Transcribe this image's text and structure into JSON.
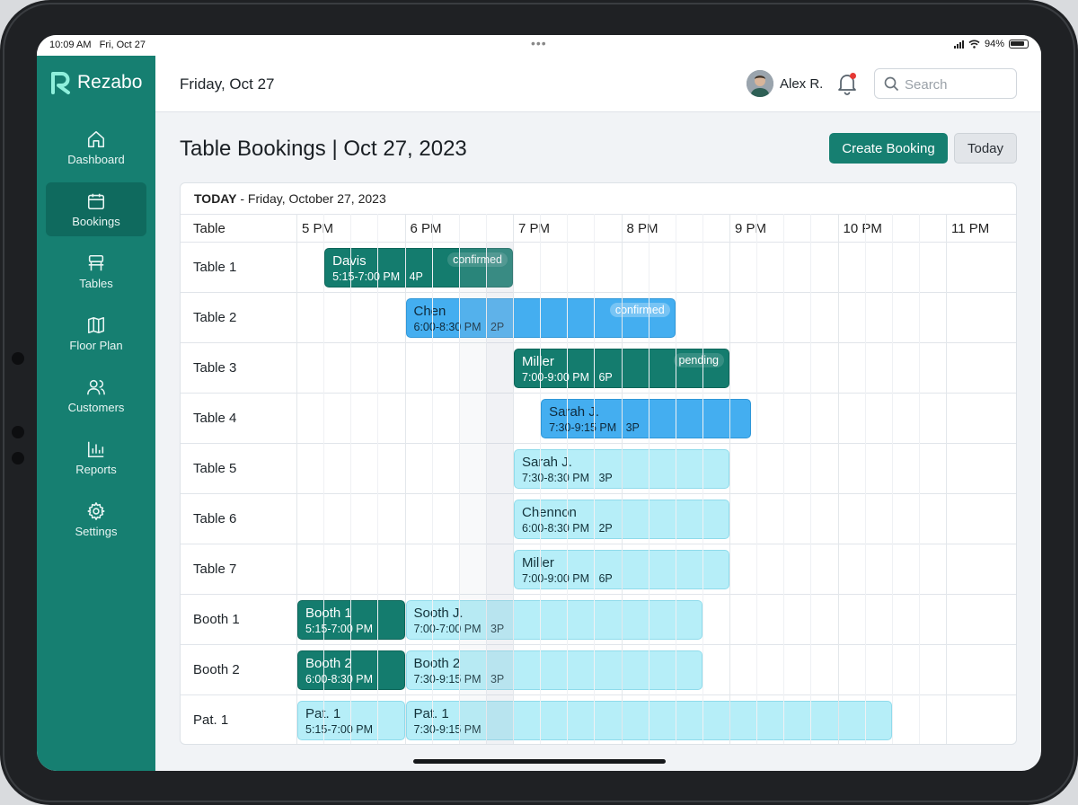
{
  "status_bar": {
    "time": "10:09 AM",
    "date": "Fri, Oct 27",
    "battery": "94%"
  },
  "brand": {
    "name": "Rezabo",
    "color": "#167f71"
  },
  "sidebar": {
    "items": [
      {
        "label": "Dashboard",
        "icon": "home-icon",
        "active": false
      },
      {
        "label": "Bookings",
        "icon": "calendar-icon",
        "active": true
      },
      {
        "label": "Tables",
        "icon": "chair-icon",
        "active": false
      },
      {
        "label": "Floor Plan",
        "icon": "map-icon",
        "active": false
      },
      {
        "label": "Customers",
        "icon": "users-icon",
        "active": false
      },
      {
        "label": "Reports",
        "icon": "bar-chart-icon",
        "active": false
      },
      {
        "label": "Settings",
        "icon": "gear-icon",
        "active": false
      }
    ]
  },
  "header": {
    "date": "Friday, Oct 27",
    "user_name": "Alex R.",
    "search_placeholder": "Search"
  },
  "page": {
    "title": "Table Bookings | Oct 27, 2023",
    "create_label": "Create Booking",
    "today_label": "Today"
  },
  "schedule": {
    "today_label": "TODAY",
    "date_label": " - Friday, October 27, 2023",
    "table_col": "Table",
    "hours": [
      "5 PM",
      "6 PM",
      "7 PM",
      "8 PM",
      "9 PM",
      "10 PM",
      "11 PM"
    ],
    "rows": [
      "Table 1",
      "Table 2",
      "Table 3",
      "Table 4",
      "Table 5",
      "Table 6",
      "Table 7",
      "Booth 1",
      "Booth 2",
      "Pat. 1"
    ],
    "bookings": [
      {
        "row": 0,
        "start": 17.25,
        "end": 19.0,
        "name": "Davis",
        "time": "5:15-7:00 PM",
        "party": "4P",
        "status": "confirmed",
        "style": "teal"
      },
      {
        "row": 1,
        "start": 18.0,
        "end": 20.5,
        "name": "Chen",
        "time": "6:00-8:30 PM",
        "party": "2P",
        "status": "confirmed",
        "style": "blue"
      },
      {
        "row": 2,
        "start": 19.0,
        "end": 21.0,
        "name": "Miller",
        "time": "7:00-9:00 PM",
        "party": "6P",
        "status": "pending",
        "style": "teal"
      },
      {
        "row": 3,
        "start": 19.25,
        "end": 21.2,
        "name": "Sarah J.",
        "time": "7:30-9:15 PM",
        "party": "3P",
        "status": "",
        "style": "blue"
      },
      {
        "row": 4,
        "start": 19.0,
        "end": 21.0,
        "name": "Sarah J.",
        "time": "7:30-8:30 PM",
        "party": "3P",
        "status": "",
        "style": "light"
      },
      {
        "row": 5,
        "start": 19.0,
        "end": 21.0,
        "name": "Chennon",
        "time": "6:00-8:30 PM",
        "party": "2P",
        "status": "",
        "style": "light"
      },
      {
        "row": 6,
        "start": 19.0,
        "end": 21.0,
        "name": "Miller",
        "time": "7:00-9:00 PM",
        "party": "6P",
        "status": "",
        "style": "light"
      },
      {
        "row": 7,
        "start": 17.0,
        "end": 18.0,
        "name": "Booth 1",
        "time": "5:15-7:00 PM",
        "party": "",
        "status": "",
        "style": "teal"
      },
      {
        "row": 7,
        "start": 18.0,
        "end": 20.75,
        "name": "Sooth J.",
        "time": "7:00-7:00 PM",
        "party": "3P",
        "status": "",
        "style": "light"
      },
      {
        "row": 8,
        "start": 17.0,
        "end": 18.0,
        "name": "Booth 2",
        "time": "6:00-8:30 PM",
        "party": "",
        "status": "",
        "style": "teal"
      },
      {
        "row": 8,
        "start": 18.0,
        "end": 20.75,
        "name": "Booth 2",
        "time": "7:30-9:15 PM",
        "party": "3P",
        "status": "",
        "style": "light"
      },
      {
        "row": 9,
        "start": 17.0,
        "end": 18.0,
        "name": "Pat. 1",
        "time": "5:15-7:00 PM",
        "party": "",
        "status": "",
        "style": "light"
      },
      {
        "row": 9,
        "start": 18.0,
        "end": 22.5,
        "name": "Pat. 1",
        "time": "7:30-9:15 PM",
        "party": "",
        "status": "",
        "style": "light"
      }
    ]
  }
}
